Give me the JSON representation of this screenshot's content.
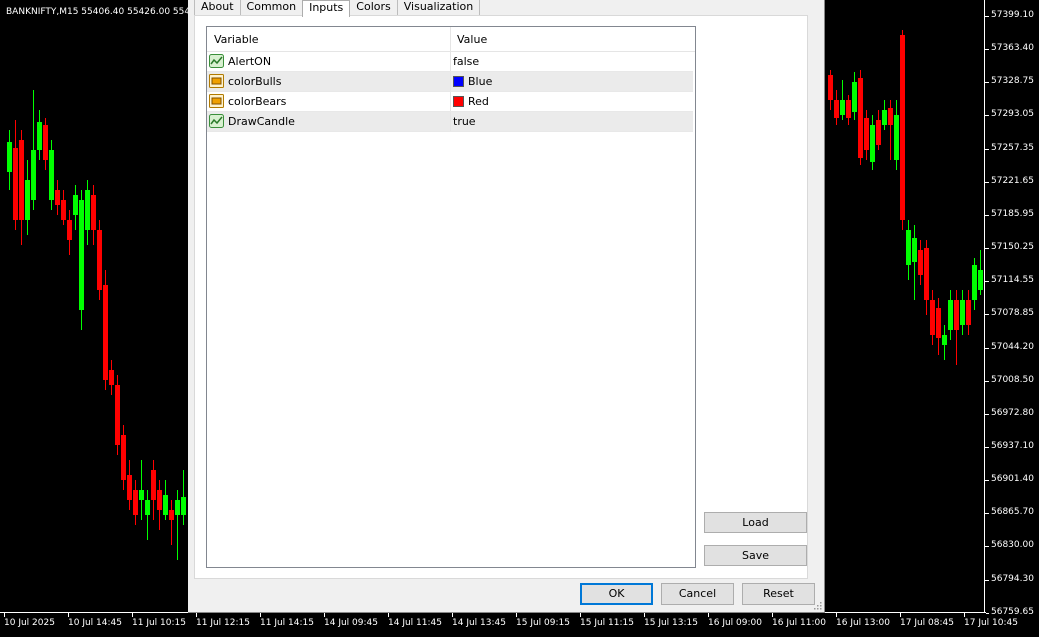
{
  "chart": {
    "title": "BANKNIFTY,M15  55406.40 55426.00 55406.40 55426.00",
    "price_labels": [
      "57399.10",
      "57363.40",
      "57328.75",
      "57293.05",
      "57257.35",
      "57221.65",
      "57185.95",
      "57150.25",
      "57114.55",
      "57078.85",
      "57044.20",
      "57008.50",
      "56972.80",
      "56937.10",
      "56901.40",
      "56865.70",
      "56830.00",
      "56794.30",
      "56759.65"
    ],
    "time_labels": [
      "10 Jul 2025",
      "10 Jul 14:45",
      "11 Jul 10:15",
      "11 Jul 12:15",
      "11 Jul 14:15",
      "14 Jul 09:45",
      "14 Jul 11:45",
      "14 Jul 13:45",
      "15 Jul 09:15",
      "15 Jul 11:15",
      "15 Jul 13:15",
      "16 Jul 09:00",
      "16 Jul 11:00",
      "16 Jul 13:00",
      "17 Jul 08:45",
      "17 Jul 10:45"
    ],
    "colors": {
      "background": "#000000",
      "bull": "#00ff00",
      "bear": "#ff0000",
      "axis": "#ffffff"
    }
  },
  "dialog": {
    "tabs": [
      {
        "label": "About",
        "active": false
      },
      {
        "label": "Common",
        "active": false
      },
      {
        "label": "Inputs",
        "active": true
      },
      {
        "label": "Colors",
        "active": false
      },
      {
        "label": "Visualization",
        "active": false
      }
    ],
    "grid": {
      "headers": {
        "variable": "Variable",
        "value": "Value"
      },
      "rows": [
        {
          "variable": "AlertON",
          "value": "false",
          "icon": "bool-icon"
        },
        {
          "variable": "colorBulls",
          "value": "Blue",
          "icon": "color-icon",
          "swatch": "#0000ff"
        },
        {
          "variable": "colorBears",
          "value": "Red",
          "icon": "color-icon",
          "swatch": "#ff0000"
        },
        {
          "variable": "DrawCandle",
          "value": "true",
          "icon": "bool-icon"
        }
      ]
    },
    "buttons": {
      "load": "Load",
      "save": "Save",
      "ok": "OK",
      "cancel": "Cancel",
      "reset": "Reset"
    }
  }
}
